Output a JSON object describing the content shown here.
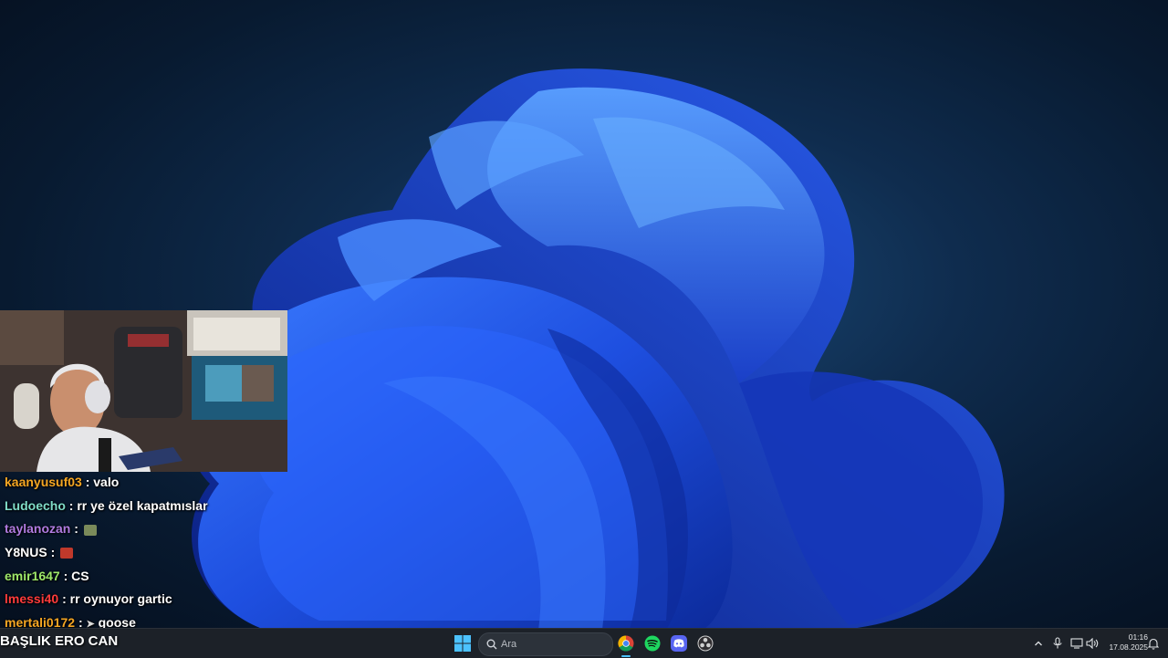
{
  "stream": {
    "title": "BAŞLIK ERO CAN"
  },
  "chat": {
    "messages": [
      {
        "user": "kaanyusuf03",
        "text": ": valo",
        "color": "#f5a623",
        "emote": null
      },
      {
        "user": "Ludoecho",
        "text": ": rr ye özel kapatmıslar",
        "color": "#7fdcc8",
        "emote": null
      },
      {
        "user": "taylanozan",
        "text": ":",
        "color": "#b07be0",
        "emote": "#7a8a5a"
      },
      {
        "user": "Y8NUS",
        "text": ":",
        "color": "#ffffff",
        "emote": "#c0392b"
      },
      {
        "user": "emir1647",
        "text": ": CS",
        "color": "#9ee86a",
        "emote": null
      },
      {
        "user": "lmessi40",
        "text": ": rr oynuyor gartic",
        "color": "#ff3b3b",
        "emote": null
      },
      {
        "user": "mertali0172",
        "text": ": ",
        "suffix": "goose",
        "color": "#f5a623",
        "emote": "#dcdcdc"
      }
    ]
  },
  "taskbar": {
    "search_placeholder": "Ara",
    "apps": [
      {
        "name": "chrome-icon"
      },
      {
        "name": "spotify-icon"
      },
      {
        "name": "discord-icon"
      },
      {
        "name": "obs-icon"
      }
    ],
    "clock_time": "01:16",
    "clock_date": "17.08.2025"
  },
  "colors": {
    "accent": "#0078d4",
    "taskbar_bg": "#1c2128",
    "wallpaper_blue": "#1e4fe0"
  }
}
